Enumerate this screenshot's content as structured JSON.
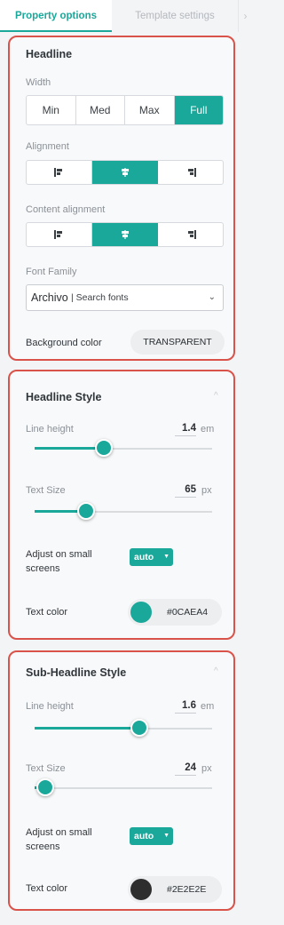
{
  "tabs": {
    "property_options": "Property options",
    "template_settings": "Template settings",
    "next_arrow": "›"
  },
  "headline": {
    "title": "Headline",
    "width_label": "Width",
    "width_options": [
      "Min",
      "Med",
      "Max",
      "Full"
    ],
    "width_selected": "Full",
    "alignment_label": "Alignment",
    "alignment_selected": "center",
    "content_alignment_label": "Content alignment",
    "content_alignment_selected": "center",
    "font_family_label": "Font Family",
    "font_value": "Archivo",
    "font_search": "| Search fonts",
    "font_chevron": "⌄",
    "bg_color_label": "Background color",
    "bg_color_value": "TRANSPARENT"
  },
  "headline_style": {
    "title": "Headline Style",
    "collapse_icon": "^",
    "line_height_label": "Line height",
    "line_height_value": "1.4",
    "line_height_unit": "em",
    "line_height_fraction": 0.39,
    "text_size_label": "Text Size",
    "text_size_value": "65",
    "text_size_unit": "px",
    "text_size_fraction": 0.29,
    "adjust_label": "Adjust on small screens",
    "adjust_value": "auto",
    "text_color_label": "Text color",
    "text_color_value": "#0CAEA4",
    "text_color_hex": "#1aa89a"
  },
  "subheadline_style": {
    "title": "Sub-Headline Style",
    "collapse_icon": "^",
    "line_height_label": "Line height",
    "line_height_value": "1.6",
    "line_height_unit": "em",
    "line_height_fraction": 0.59,
    "text_size_label": "Text Size",
    "text_size_value": "24",
    "text_size_unit": "px",
    "text_size_fraction": 0.06,
    "adjust_label": "Adjust on small screens",
    "adjust_value": "auto",
    "text_color_label": "Text color",
    "text_color_value": "#2E2E2E",
    "text_color_hex": "#2e2e2e"
  },
  "colors": {
    "accent": "#1aa89a",
    "highlight_border": "#d9534a"
  }
}
